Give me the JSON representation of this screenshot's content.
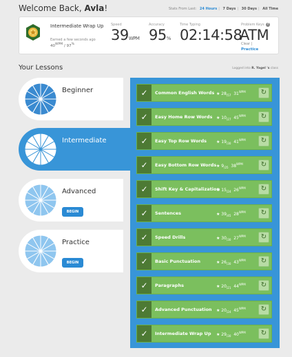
{
  "header": {
    "welcome_prefix": "Welcome Back, ",
    "user_name": "Avla",
    "welcome_suffix": "!",
    "stats_from_label": "Stats From Last:",
    "ranges": [
      "24 Hours",
      "7 Days",
      "30 Days",
      "All Time"
    ]
  },
  "stats": {
    "badge_title": "Intermediate Wrap Up",
    "badge_earned": "Earned a few seconds ago",
    "badge_wpm": "40",
    "badge_wpm_unit": "WPM",
    "badge_acc": " / 97",
    "badge_acc_unit": "%",
    "speed_label": "Speed",
    "speed_value": "39",
    "speed_unit": "WPM",
    "accuracy_label": "Accuracy",
    "accuracy_value": "95",
    "accuracy_unit": "%",
    "time_label": "Time Typing",
    "time_value": "02:14:58",
    "problem_label": "Problem Keys",
    "problem_value": "ATM",
    "clear_label": "Clear |",
    "practice_label": "Practice"
  },
  "lessons_section": {
    "title": "Your Lessons",
    "logged_into_prefix": "Logged into ",
    "teacher": "R. Yagel 's",
    "logged_into_suffix": " class"
  },
  "lessons": [
    {
      "name": "Beginner",
      "color": "#3a8ad0"
    },
    {
      "name": "Intermediate",
      "color": "#ffffff"
    },
    {
      "name": "Advanced",
      "color": "#8fc6ef",
      "button": "BEGIN"
    },
    {
      "name": "Practice",
      "color": "#8fc6ef",
      "button": "BEGIN"
    }
  ],
  "rows": [
    {
      "name": "Common English Words",
      "stars": "★ 28",
      "stars_total": "/57",
      "wpm": "31",
      "unit": "WPM"
    },
    {
      "name": "Easy Home Row Words",
      "stars": "★ 10",
      "stars_total": "/27",
      "wpm": "45",
      "unit": "WPM"
    },
    {
      "name": "Easy Top Row Words",
      "stars": "★ 19",
      "stars_total": "/30",
      "wpm": "41",
      "unit": "WPM"
    },
    {
      "name": "Easy Bottom Row Words",
      "stars": "★ 9",
      "stars_total": "/25",
      "wpm": "38",
      "unit": "WPM"
    },
    {
      "name": "Shift Key & Capitalization",
      "stars": "★ 15",
      "stars_total": "/24",
      "wpm": "26",
      "unit": "WPM"
    },
    {
      "name": "Sentences",
      "stars": "★ 39",
      "stars_total": "/45",
      "wpm": "28",
      "unit": "WPM"
    },
    {
      "name": "Speed Drills",
      "stars": "★ 30",
      "stars_total": "/30",
      "wpm": "27",
      "unit": "WPM"
    },
    {
      "name": "Basic Punctuation",
      "stars": "★ 26",
      "stars_total": "/30",
      "wpm": "43",
      "unit": "WPM"
    },
    {
      "name": "Paragraphs",
      "stars": "★ 20",
      "stars_total": "/21",
      "wpm": "44",
      "unit": "WPM"
    },
    {
      "name": "Advanced Punctuation",
      "stars": "★ 20",
      "stars_total": "/24",
      "wpm": "45",
      "unit": "WPM"
    },
    {
      "name": "Intermediate Wrap Up",
      "stars": "★ 29",
      "stars_total": "/30",
      "wpm": "40",
      "unit": "WPM"
    }
  ],
  "icons": {
    "check": "check-icon",
    "redo": "redo-icon",
    "star": "star-icon",
    "badge": "medal-icon"
  }
}
